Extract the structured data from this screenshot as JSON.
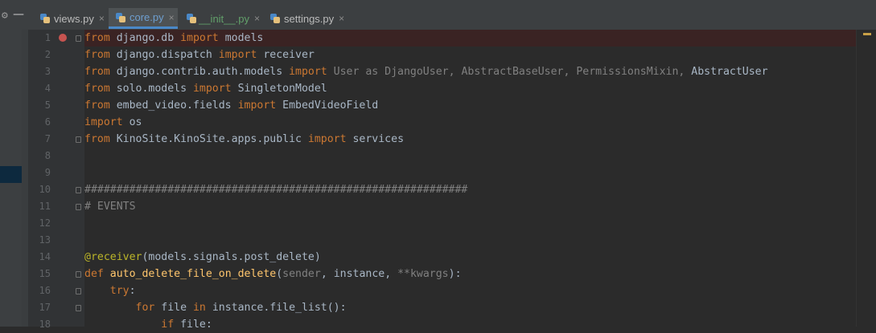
{
  "tabs": [
    {
      "label": "views.py",
      "active": false,
      "icon": "python-file-icon"
    },
    {
      "label": "core.py",
      "active": true,
      "icon": "python-file-icon"
    },
    {
      "label": "__init__.py",
      "active": false,
      "icon": "python-file-icon"
    },
    {
      "label": "settings.py",
      "active": false,
      "icon": "python-file-icon"
    }
  ],
  "close_glyph": "×",
  "colors": {
    "background": "#2b2b2b",
    "keyword": "#cc7832",
    "function": "#ffc66d",
    "decorator": "#bbb529",
    "comment": "#808080",
    "breakpoint": "#c75450"
  },
  "gutter": {
    "line_numbers": [
      "1",
      "2",
      "3",
      "4",
      "5",
      "6",
      "7",
      "8",
      "9",
      "10",
      "11",
      "12",
      "13",
      "14",
      "15",
      "16",
      "17",
      "18"
    ],
    "breakpoint_line": 1
  },
  "code": {
    "l1": {
      "a": "from",
      "b": " django.db ",
      "c": "import",
      "d": " models"
    },
    "l2": {
      "a": "from",
      "b": " django.dispatch ",
      "c": "import",
      "d": " receiver"
    },
    "l3": {
      "a": "from",
      "b": " django.contrib.auth.models ",
      "c": "import",
      "d": " User as DjangoUser, AbstractBaseUser, PermissionsMixin, ",
      "e": "AbstractUser"
    },
    "l4": {
      "a": "from",
      "b": " solo.models ",
      "c": "import",
      "d": " SingletonModel"
    },
    "l5": {
      "a": "from",
      "b": " embed_video.fields ",
      "c": "import",
      "d": " EmbedVideoField"
    },
    "l6": {
      "a": "import",
      "b": " os"
    },
    "l7": {
      "a": "from",
      "b": " KinoSite.KinoSite.apps.public ",
      "c": "import",
      "d": " services"
    },
    "l10": "############################################################",
    "l11": "# EVENTS",
    "l14": {
      "a": "@receiver",
      "b": "(models.signals.post_delete)"
    },
    "l15": {
      "a": "def",
      "b": " ",
      "c": "auto_delete_file_on_delete",
      "d": "(",
      "e": "sender",
      "f": ", instance, ",
      "g": "**kwargs",
      "h": "):"
    },
    "l16": {
      "a": "    try",
      "b": ":"
    },
    "l17": {
      "a": "        for",
      "b": " file ",
      "c": "in",
      "d": " instance.file_list():"
    },
    "l18": {
      "a": "            if",
      "b": " file:"
    }
  }
}
